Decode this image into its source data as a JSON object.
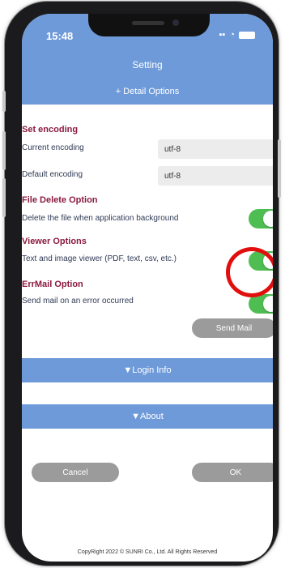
{
  "status_bar": {
    "time": "15:48"
  },
  "header": {
    "title": "Setting"
  },
  "detail_options": {
    "label": "+ Detail Options"
  },
  "encoding": {
    "heading": "Set encoding",
    "current_label": "Current encoding",
    "current_value": "utf-8",
    "default_label": "Default encoding",
    "default_value": "utf-8"
  },
  "file_delete": {
    "heading": "File Delete Option",
    "label": "Delete the file when application background",
    "enabled": true
  },
  "viewer": {
    "heading": "Viewer Options",
    "label": "Text and image viewer (PDF, text, csv, etc.)",
    "enabled": true
  },
  "errmail": {
    "heading": "ErrMail Option",
    "label": "Send mail on an error occurred",
    "enabled": true,
    "send_button": "Send Mail"
  },
  "login_info": {
    "label": "▼Login Info"
  },
  "about": {
    "label": "▼About"
  },
  "actions": {
    "cancel": "Cancel",
    "ok": "OK"
  },
  "footer": {
    "copyright": "CopyRight 2022 © SUNRI Co., Ltd. All Rights Reserved"
  },
  "colors": {
    "accent": "#6e9ad9",
    "heading": "#8b1a3f",
    "toggle_on": "#4fbe52",
    "highlight": "#e10e0e"
  }
}
